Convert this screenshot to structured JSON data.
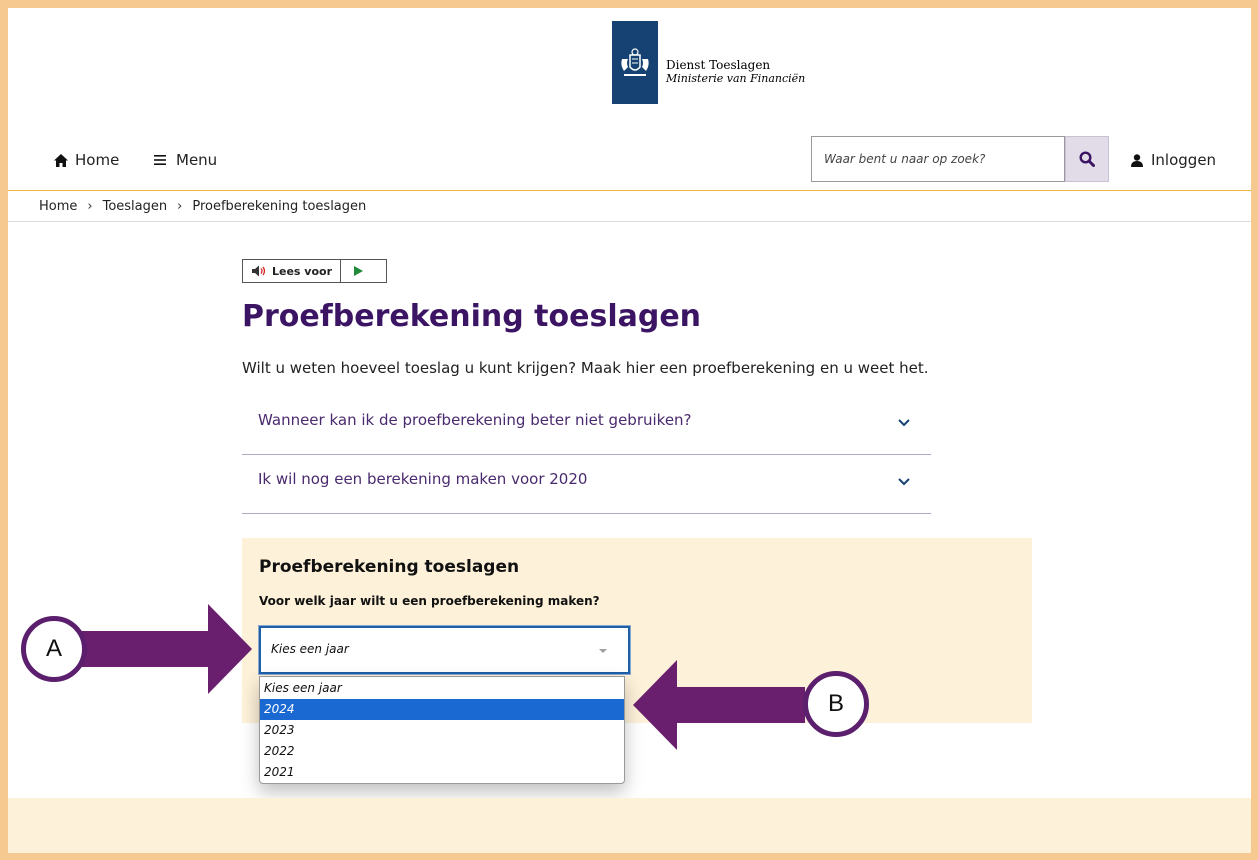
{
  "header": {
    "org_name": "Dienst Toeslagen",
    "org_sub": "Ministerie van Financiën"
  },
  "nav": {
    "home": "Home",
    "menu": "Menu",
    "search_placeholder": "Waar bent u naar op zoek?",
    "login": "Inloggen"
  },
  "breadcrumb": [
    "Home",
    "Toeslagen",
    "Proefberekening toeslagen"
  ],
  "readaloud": {
    "label": "Lees voor"
  },
  "main": {
    "title": "Proefberekening toeslagen",
    "intro": "Wilt u weten hoeveel toeslag u kunt krijgen? Maak hier een proefberekening en u weet het.",
    "accordion": [
      "Wanneer kan ik de proefberekening beter niet gebruiken?",
      "Ik wil nog een berekening maken voor 2020"
    ]
  },
  "panel": {
    "title": "Proefberekening toeslagen",
    "question": "Voor welk jaar wilt u een proefberekening maken?",
    "select_value": "Kies een jaar",
    "options": [
      "Kies een jaar",
      "2024",
      "2023",
      "2022",
      "2021"
    ],
    "highlighted_option": "2024"
  },
  "annotations": {
    "a": "A",
    "b": "B"
  },
  "colors": {
    "frame": "#f5c98f",
    "title_purple": "#3c1464",
    "arrow_purple": "#6a1f6e",
    "highlight": "#1a68d1",
    "panel_bg": "#fdf1d9",
    "logo_blue": "#154273"
  }
}
